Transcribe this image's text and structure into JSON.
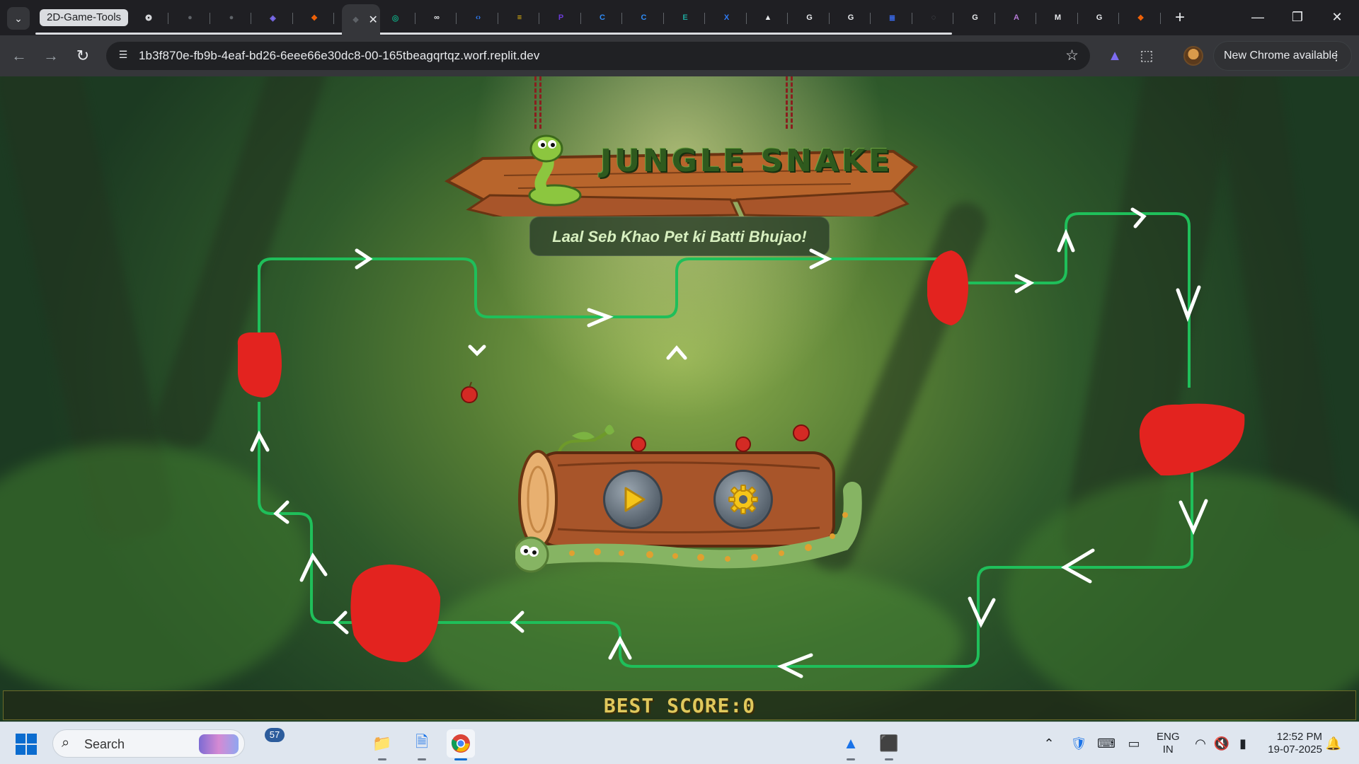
{
  "browser": {
    "tab_group_label": "2D-Game-Tools",
    "url": "1b3f870e-fb9b-4eaf-bd26-6eee66e30dc8-00-165tbeagqrtqz.worf.replit.dev",
    "update_button_label": "New Chrome available",
    "tabs": [
      {
        "icon": "openai-icon",
        "color": "#e8eaed"
      },
      {
        "icon": "github-icon",
        "color": "#5f6368"
      },
      {
        "icon": "github-icon",
        "color": "#5f6368"
      },
      {
        "icon": "copilot-icon",
        "color": "#7c6cf0"
      },
      {
        "icon": "replit-icon",
        "color": "#f26207"
      },
      {
        "icon": "replit-icon",
        "color": "#5f6368",
        "active": true
      },
      {
        "icon": "chatgpt-icon",
        "color": "#10a37f"
      },
      {
        "icon": "infinity-icon",
        "color": "#e8eaed"
      },
      {
        "icon": "code-icon",
        "color": "#2f7cf6"
      },
      {
        "icon": "stack-icon",
        "color": "#f4c20d"
      },
      {
        "icon": "p-icon",
        "color": "#6b3ad6"
      },
      {
        "icon": "c-icon",
        "color": "#2f8cf6"
      },
      {
        "icon": "c-icon",
        "color": "#2f8cf6"
      },
      {
        "icon": "edge-icon",
        "color": "#1ea39a"
      },
      {
        "icon": "x-icon",
        "color": "#2f7cf6"
      },
      {
        "icon": "triangle-icon",
        "color": "#e8eaed"
      },
      {
        "icon": "google-icon",
        "color": "#e8eaed"
      },
      {
        "icon": "google-icon",
        "color": "#e8eaed"
      },
      {
        "icon": "forms-icon",
        "color": "#3b6ef6"
      },
      {
        "icon": "globe-icon",
        "color": "#5f6368"
      },
      {
        "icon": "google-icon",
        "color": "#e8eaed"
      },
      {
        "icon": "ai-icon",
        "color": "#b57bd6"
      },
      {
        "icon": "m-icon",
        "color": "#e8eaed"
      },
      {
        "icon": "google-icon",
        "color": "#e8eaed"
      },
      {
        "icon": "replit-icon",
        "color": "#f26207"
      }
    ]
  },
  "game": {
    "title": "JUNGLE SNAKE",
    "tagline": "Laal Seb Khao Pet ki Batti Bhujao!",
    "best_score_label": "BEST SCORE:0",
    "play_button_icon": "play-icon",
    "settings_button_icon": "gear-icon",
    "colors": {
      "path": "#1fbf5a",
      "apple": "#e3231f",
      "wood": "#a8552a",
      "snake": "#86b463"
    }
  },
  "taskbar": {
    "search_placeholder": "Search",
    "notification_count": "57",
    "language": "ENG",
    "region": "IN",
    "time": "12:52 PM",
    "date": "19-07-2025"
  }
}
